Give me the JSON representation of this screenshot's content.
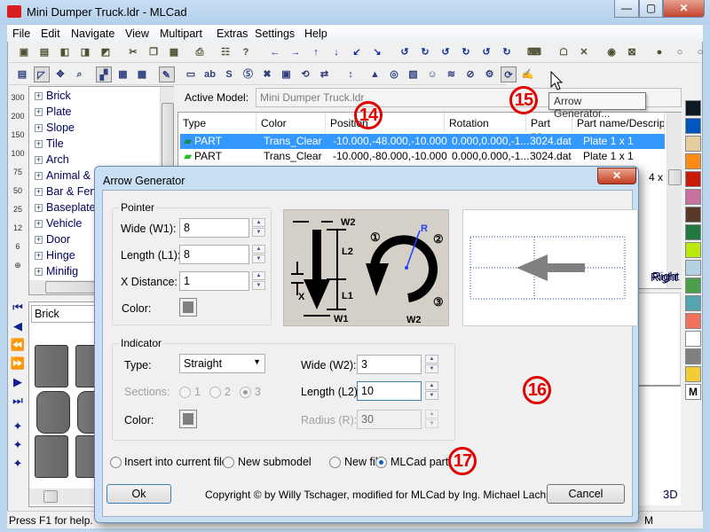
{
  "window": {
    "title": "Mini Dumper Truck.ldr - MLCad",
    "minimize": "—",
    "maximize": "▢",
    "close": "✕"
  },
  "menu": [
    "File",
    "Edit",
    "Navigate",
    "View",
    "Multipart",
    "Extras",
    "Settings",
    "Help"
  ],
  "toolbar1": [
    "new-icon",
    "open-icon",
    "save-icon",
    "save-as-icon",
    "save-all-icon",
    "cut-icon",
    "copy-icon",
    "paste-icon",
    "print-icon",
    "properties-icon",
    "help-pointer-icon",
    "move-neg-x-icon",
    "move-pos-x-icon",
    "move-neg-y-icon",
    "move-pos-y-icon",
    "move-z-icon",
    "move-neg-z-icon",
    "rotate-x-icon",
    "rotate-x2-icon",
    "rotate-y-icon",
    "rotate-y2-icon",
    "rotate-z-icon",
    "rotate-z2-icon",
    "keyboard-icon",
    "ghost-icon",
    "unghost-icon",
    "color-icon",
    "hide-icon",
    "light-icon",
    "light-off-icon",
    "lights-icon"
  ],
  "toolbar2": [
    "views-icon",
    "edit-mode-icon",
    "move-icon",
    "zoom-find-icon",
    "grid-coarse-icon",
    "grid-medium-icon",
    "grid-fine-icon",
    "draw-icon",
    "insert-icon",
    "text-icon",
    "insert-step-icon",
    "insert-submodel-icon",
    "delete-icon",
    "insert-picture-icon",
    "rotation-step-icon",
    "buffer-exchange-icon",
    "spacer-icon",
    "landscape-icon",
    "rotation-point-icon",
    "pict-icon",
    "minifig-icon",
    "spring-icon",
    "flex-icon",
    "hose-icon",
    "arrow-generator-icon",
    "edit-part-icon"
  ],
  "lefttools": [
    "300",
    "200",
    "150",
    "100",
    "75",
    "50",
    "25",
    "12",
    "6",
    "⊕"
  ],
  "navtools": [
    "first-step-icon",
    "prev-step-icon",
    "rewind-icon",
    "fast-forward-icon",
    "next-step-icon",
    "last-step-icon",
    "wizard-icon",
    "wizard-pp-icon",
    "wizard-cc-icon"
  ],
  "tree": [
    "Brick",
    "Plate",
    "Slope",
    "Tile",
    "Arch",
    "Animal & ...",
    "Bar & Fence",
    "Baseplate",
    "Vehicle",
    "Door",
    "Hinge",
    "Minifig"
  ],
  "parts": {
    "category": "Brick"
  },
  "model": {
    "label": "Active Model:",
    "value": "Mini Dumper Truck.ldr"
  },
  "tooltip": "Arrow Generator...",
  "partlist": {
    "columns": [
      "Type",
      "Color",
      "Position",
      "Rotation",
      "Part no....",
      "Part name/Descript"
    ],
    "rows": [
      {
        "type": "PART",
        "color": "Trans_Clear",
        "position": "-10.000,-48.000,-10.000",
        "rotation": "0.000,0.000,-1...",
        "part": "3024.dat",
        "name": "Plate  1 x  1",
        "selected": true
      },
      {
        "type": "PART",
        "color": "Trans_Clear",
        "position": "-10.000,-80.000,-10.000",
        "rotation": "0.000,0.000,-1...",
        "part": "3024.dat",
        "name": "Plate  1 x  1",
        "selected": false
      }
    ],
    "overflow": "4 x"
  },
  "views": {
    "right": "Right",
    "three_d": "3D",
    "status_m": "M"
  },
  "palette": [
    "#0d1a24",
    "#0055bf",
    "#e4cd9e",
    "#fe8a18",
    "#c91a09",
    "#c870a0",
    "#583927",
    "#237841",
    "#bbe90b",
    "#b4d2e3",
    "#4b9f4a",
    "#55a5af",
    "#f2705e",
    "#ffffff",
    "#808080",
    "#f2cd37"
  ],
  "palette_more": "M",
  "status": "Press F1 for help.",
  "callouts": [
    "14",
    "15",
    "16",
    "17"
  ],
  "dialog": {
    "title": "Arrow Generator",
    "close": "✕",
    "pointer": {
      "title": "Pointer",
      "wide_label": "Wide (W1):",
      "wide": "8",
      "length_label": "Length (L1):",
      "length": "8",
      "xdist_label": "X Distance:",
      "xdist": "1",
      "color_label": "Color:",
      "color": "#808080"
    },
    "diagram": {
      "w2": "W2",
      "l2": "L2",
      "l1": "L1",
      "x": "X",
      "w1": "W1",
      "r": "R",
      "s1": "①",
      "s2": "②",
      "s3": "③"
    },
    "indicator": {
      "title": "Indicator",
      "type_label": "Type:",
      "type": "Straight",
      "sections_label": "Sections:",
      "sections": [
        "1",
        "2",
        "3"
      ],
      "sections_selected": "3",
      "color_label": "Color:",
      "color": "#808080",
      "wide_label": "Wide (W2):",
      "wide": "3",
      "length_label": "Length (L2):",
      "length": "10",
      "radius_label": "Radius (R):",
      "radius": "30"
    },
    "output": {
      "options": [
        "Insert into current file",
        "New submodel",
        "New file",
        "MLCad part"
      ],
      "selected": "MLCad part"
    },
    "ok": "Ok",
    "cancel": "Cancel",
    "copyright": "Copyright © by Willy Tschager, modified for MLCad by Ing. Michael Lachmann"
  }
}
